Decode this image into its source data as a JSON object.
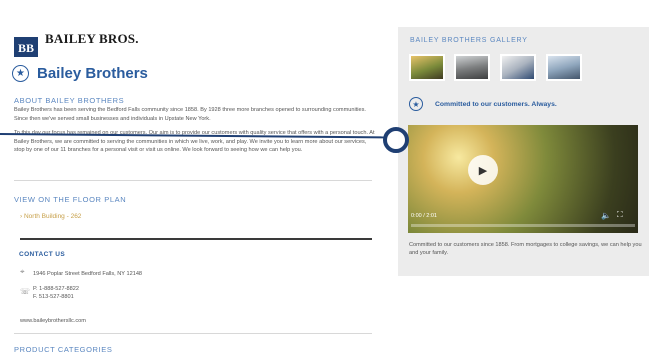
{
  "header": {
    "logo_mark": "BB",
    "logo_text": "BAILEY BROS."
  },
  "page": {
    "title": "Bailey Brothers"
  },
  "about": {
    "heading": "ABOUT BAILEY BROTHERS",
    "paragraph_1": "Bailey Brothers has been serving the Bedford Falls community since 1858. By 1928 three more branches opened to surrounding communities. Since then we've served small businesses and individuals in Upstate New York.",
    "paragraph_2": "To this day our focus has remained on our customers. Our aim is to provide our customers with quality service that offers with a personal touch. At Bailey Brothers, we are committed to serving the communities in which we live, work, and play. We invite you to learn more about our services, stop by one of our 11 branches for a personal visit or visit us online. We look forward to seeing how we can help you."
  },
  "floor_plan": {
    "heading": "VIEW ON THE FLOOR PLAN",
    "link": "› North Building - 262"
  },
  "contact": {
    "heading": "CONTACT US",
    "address": "1946 Poplar Street Bedford Falls, NY 12148",
    "phone": "P. 1-888-527-8822",
    "fax": "F. 513-527-8801",
    "website": "www.baileybrothersllc.com"
  },
  "product_categories": {
    "heading": "PRODUCT CATEGORIES"
  },
  "gallery": {
    "heading": "BAILEY BROTHERS GALLERY",
    "thumb_count": 4
  },
  "committed": {
    "text": "Committed to our customers. Always."
  },
  "video": {
    "time": "0:00 / 2:01",
    "progress": 0.0
  },
  "caption": {
    "text": "Committed to our customers since 1858. From mortgages to college savings, we can help you and your family."
  },
  "icons": {
    "star": "star-icon",
    "play": "play-icon",
    "volume": "volume-icon",
    "fullscreen": "fullscreen-icon",
    "location": "location-pin-icon",
    "phone": "phone-icon"
  },
  "colors": {
    "brand_blue": "#2a5c9e",
    "logo_navy": "#1f3f73",
    "accent_gold": "#c7a04a",
    "panel_gray": "#ececec"
  }
}
